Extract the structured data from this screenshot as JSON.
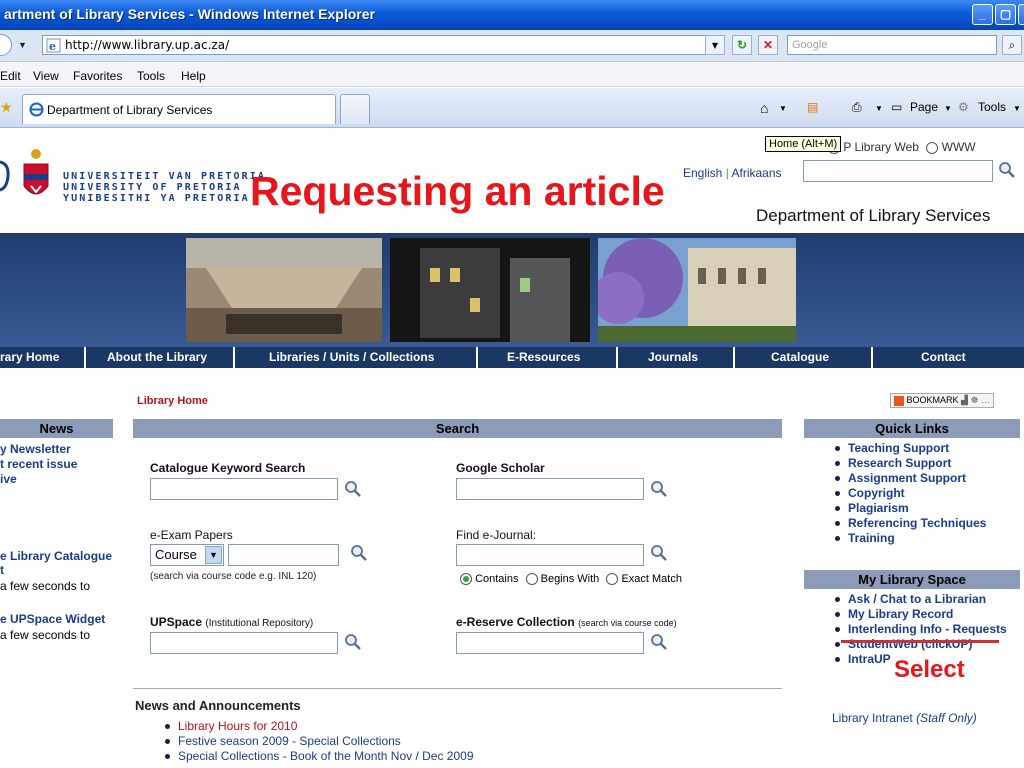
{
  "browser": {
    "window_title": "artment of Library Services - Windows Internet Explorer",
    "url": "http://www.library.up.ac.za/",
    "search_placeholder": "Google",
    "menu": [
      "Edit",
      "View",
      "Favorites",
      "Tools",
      "Help"
    ],
    "tab_title": "Department of Library Services",
    "toolbar_page": "Page",
    "toolbar_tools": "Tools",
    "tooltip": "Home (Alt+M)"
  },
  "header": {
    "university_lines": [
      "UNIVERSITEIT VAN PRETORIA",
      "UNIVERSITY OF PRETORIA",
      "YUNIBESITHI YA PRETORIA"
    ],
    "overlay_title": "Requesting an article",
    "lang_english": "English",
    "lang_sep": "|",
    "lang_afrikaans": "Afrikaans",
    "scope_option_1": "P Library Web",
    "scope_option_2": "WWW",
    "department": "Department of Library Services",
    "colors": {
      "overlay_title": "#e8151b",
      "navbar": "#1b3764",
      "section_header": "#8b9bb8"
    }
  },
  "nav": [
    "rary Home",
    "About the Library",
    "Libraries / Units / Collections",
    "E-Resources",
    "Journals",
    "Catalogue",
    "Contact"
  ],
  "breadcrumb": "Library Home",
  "bookmark": "BOOKMARK",
  "left": {
    "heading": "News",
    "items": [
      "y Newsletter",
      "t recent issue",
      "ive"
    ],
    "link1": "e Library Catalogue",
    "link1_cont": "t",
    "note1": "a few seconds to",
    "link2": "e UPSpace Widget",
    "note2": "a few seconds to"
  },
  "search": {
    "heading": "Search",
    "catalogue_label": "Catalogue Keyword Search",
    "scholar_label": "Google Scholar",
    "exam_label": "e-Exam Papers",
    "exam_select": "Course",
    "exam_note": "(search via course code e.g. INL 120)",
    "journal_label": "Find e-Journal:",
    "journal_opt1": "Contains",
    "journal_opt2": "Begins With",
    "journal_opt3": "Exact Match",
    "upspace_label": "UPSpace",
    "upspace_note": "(Institutional Repository)",
    "ereserve_label": "e-Reserve Collection",
    "ereserve_note": "(search via course code)"
  },
  "news": {
    "heading": "News and Announcements",
    "items": [
      "Library Hours for 2010",
      "Festive season 2009 - Special Collections",
      "Special Collections - Book of the Month Nov / Dec 2009"
    ]
  },
  "quick_links": {
    "heading": "Quick Links",
    "items": [
      "Teaching Support",
      "Research Support",
      "Assignment Support",
      "Copyright",
      "Plagiarism",
      "Referencing Techniques",
      "Training"
    ]
  },
  "library_space": {
    "heading": "My Library Space",
    "items": [
      "Ask / Chat to a Librarian",
      "My Library Record",
      "Interlending Info - Requests",
      "StudentWeb (clickUP)",
      "IntraUP"
    ],
    "select_annotation": "Select",
    "intranet": "Library Intranet",
    "intranet_note": "(Staff Only)"
  }
}
